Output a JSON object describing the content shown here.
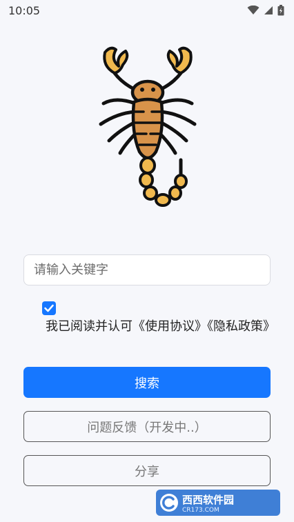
{
  "status_bar": {
    "time": "10:05",
    "icons": [
      "wifi-icon",
      "signal-icon",
      "battery-icon"
    ]
  },
  "logo": {
    "icon": "scorpion-icon"
  },
  "search": {
    "placeholder": "请输入关键字",
    "value": ""
  },
  "agreement": {
    "checked": true,
    "text": "我已阅读并认可《使用协议》《隐私政策》"
  },
  "buttons": {
    "search": "搜索",
    "feedback": "问题反馈（开发中..）",
    "share": "分享"
  },
  "watermark": {
    "title": "西西软件园",
    "sub": "CR173.COM"
  },
  "colors": {
    "primary": "#1677ff",
    "background": "#f6f7fb",
    "scorpion_body": "#d8934a",
    "scorpion_segments": "#f1b94e"
  }
}
